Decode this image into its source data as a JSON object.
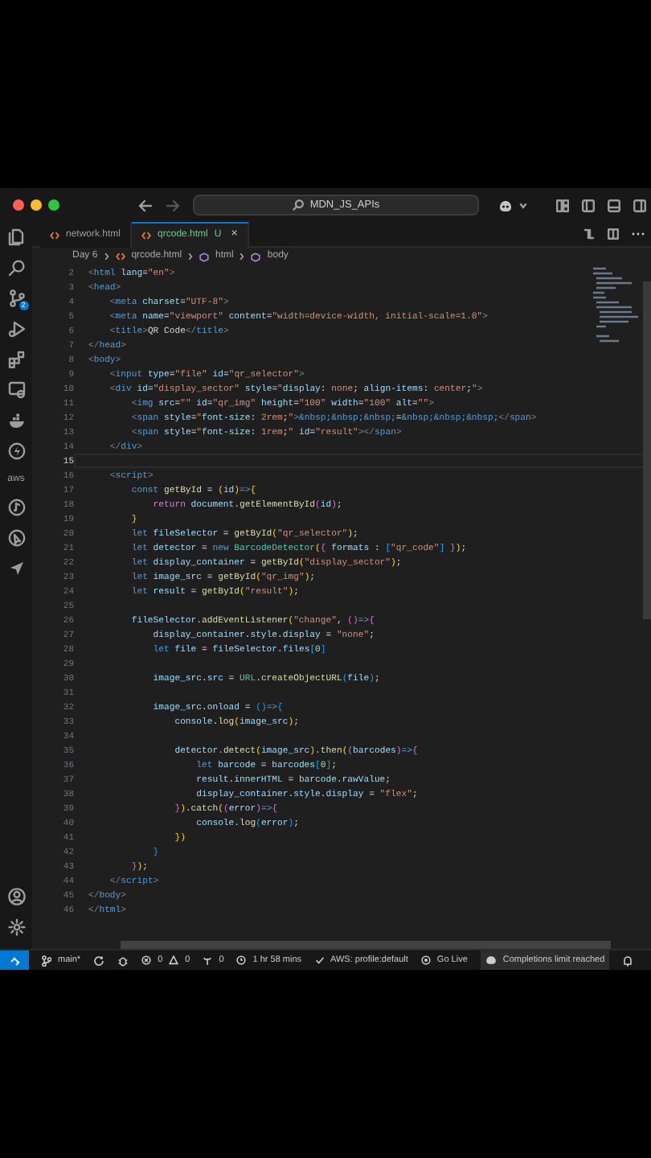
{
  "window": {
    "search": "MDN_JS_APIs"
  },
  "tabs": [
    {
      "label": "network.html",
      "selected": false
    },
    {
      "label": "qrcode.html",
      "selected": true,
      "badge": "U",
      "close": "×"
    }
  ],
  "breadcrumb": [
    {
      "label": "Day 6",
      "kind": "folder"
    },
    {
      "label": "qrcode.html",
      "kind": "file"
    },
    {
      "label": "html",
      "kind": "element"
    },
    {
      "label": "body",
      "kind": "element"
    }
  ],
  "activity_bar": {
    "scm_badge": "2",
    "aws_label": "aws"
  },
  "editor": {
    "lines": [
      {
        "number": "2",
        "current": false,
        "tokens": [
          {
            "kind": "delimiter",
            "text": "<"
          },
          {
            "kind": "tag",
            "text": "html"
          },
          {
            "kind": "attribute",
            "text": " lang"
          },
          {
            "kind": "plain",
            "text": "="
          },
          {
            "kind": "string",
            "text": "\"en\""
          },
          {
            "kind": "delimiter",
            "text": ">"
          }
        ]
      },
      {
        "number": "3",
        "current": false,
        "tokens": [
          {
            "kind": "delimiter",
            "text": "<"
          },
          {
            "kind": "tag",
            "text": "head"
          },
          {
            "kind": "delimiter",
            "text": ">"
          }
        ]
      },
      {
        "number": "4",
        "current": false,
        "tokens": [
          {
            "kind": "delimiter",
            "text": "    <"
          },
          {
            "kind": "tag",
            "text": "meta"
          },
          {
            "kind": "attribute",
            "text": " charset"
          },
          {
            "kind": "plain",
            "text": "="
          },
          {
            "kind": "string",
            "text": "\"UTF-8\""
          },
          {
            "kind": "delimiter",
            "text": ">"
          }
        ]
      },
      {
        "number": "5",
        "current": false,
        "tokens": [
          {
            "kind": "delimiter",
            "text": "    <"
          },
          {
            "kind": "tag",
            "text": "meta"
          },
          {
            "kind": "attribute",
            "text": " name"
          },
          {
            "kind": "plain",
            "text": "="
          },
          {
            "kind": "string",
            "text": "\"viewport\""
          },
          {
            "kind": "attribute",
            "text": " content"
          },
          {
            "kind": "plain",
            "text": "="
          },
          {
            "kind": "string",
            "text": "\"width=device-width, initial-scale=1.0\""
          },
          {
            "kind": "delimiter",
            "text": ">"
          }
        ]
      },
      {
        "number": "6",
        "current": false,
        "tokens": [
          {
            "kind": "delimiter",
            "text": "    <"
          },
          {
            "kind": "tag",
            "text": "title"
          },
          {
            "kind": "delimiter",
            "text": ">"
          },
          {
            "kind": "plain",
            "text": "QR Code"
          },
          {
            "kind": "delimiter",
            "text": "</"
          },
          {
            "kind": "tag",
            "text": "title"
          },
          {
            "kind": "delimiter",
            "text": ">"
          }
        ]
      },
      {
        "number": "7",
        "current": false,
        "tokens": [
          {
            "kind": "delimiter",
            "text": "</"
          },
          {
            "kind": "tag",
            "text": "head"
          },
          {
            "kind": "delimiter",
            "text": ">"
          }
        ]
      },
      {
        "number": "8",
        "current": false,
        "tokens": [
          {
            "kind": "delimiter",
            "text": "<"
          },
          {
            "kind": "tag",
            "text": "body"
          },
          {
            "kind": "delimiter",
            "text": ">"
          }
        ]
      },
      {
        "number": "9",
        "current": false,
        "tokens": [
          {
            "kind": "delimiter",
            "text": "    <"
          },
          {
            "kind": "tag",
            "text": "input"
          },
          {
            "kind": "attribute",
            "text": " type"
          },
          {
            "kind": "plain",
            "text": "="
          },
          {
            "kind": "string",
            "text": "\"file\""
          },
          {
            "kind": "attribute",
            "text": " id"
          },
          {
            "kind": "plain",
            "text": "="
          },
          {
            "kind": "string",
            "text": "\"qr_selector\""
          },
          {
            "kind": "delimiter",
            "text": ">"
          }
        ]
      },
      {
        "number": "10",
        "current": false,
        "tokens": [
          {
            "kind": "delimiter",
            "text": "    <"
          },
          {
            "kind": "tag",
            "text": "div"
          },
          {
            "kind": "attribute",
            "text": " id"
          },
          {
            "kind": "plain",
            "text": "="
          },
          {
            "kind": "string",
            "text": "\"display_sector\""
          },
          {
            "kind": "attribute",
            "text": " style"
          },
          {
            "kind": "plain",
            "text": "="
          },
          {
            "kind": "string",
            "text": "\""
          },
          {
            "kind": "attribute",
            "text": "display"
          },
          {
            "kind": "plain",
            "text": ": "
          },
          {
            "kind": "string",
            "text": "none"
          },
          {
            "kind": "plain",
            "text": "; "
          },
          {
            "kind": "attribute",
            "text": "align-items"
          },
          {
            "kind": "plain",
            "text": ": "
          },
          {
            "kind": "string",
            "text": "center"
          },
          {
            "kind": "plain",
            "text": ";"
          },
          {
            "kind": "string",
            "text": "\""
          },
          {
            "kind": "delimiter",
            "text": ">"
          }
        ]
      },
      {
        "number": "11",
        "current": false,
        "tokens": [
          {
            "kind": "delimiter",
            "text": "        <"
          },
          {
            "kind": "tag",
            "text": "img"
          },
          {
            "kind": "attribute",
            "text": " src"
          },
          {
            "kind": "plain",
            "text": "="
          },
          {
            "kind": "string",
            "text": "\"\""
          },
          {
            "kind": "attribute",
            "text": " id"
          },
          {
            "kind": "plain",
            "text": "="
          },
          {
            "kind": "string",
            "text": "\"qr_img\""
          },
          {
            "kind": "attribute",
            "text": " height"
          },
          {
            "kind": "plain",
            "text": "="
          },
          {
            "kind": "string",
            "text": "\"100\""
          },
          {
            "kind": "attribute",
            "text": " width"
          },
          {
            "kind": "plain",
            "text": "="
          },
          {
            "kind": "string",
            "text": "\"100\""
          },
          {
            "kind": "attribute",
            "text": " alt"
          },
          {
            "kind": "plain",
            "text": "="
          },
          {
            "kind": "string",
            "text": "\"\""
          },
          {
            "kind": "delimiter",
            "text": ">"
          }
        ]
      },
      {
        "number": "12",
        "current": false,
        "tokens": [
          {
            "kind": "delimiter",
            "text": "        <"
          },
          {
            "kind": "tag",
            "text": "span"
          },
          {
            "kind": "attribute",
            "text": " style"
          },
          {
            "kind": "plain",
            "text": "="
          },
          {
            "kind": "string",
            "text": "\""
          },
          {
            "kind": "attribute",
            "text": "font-size"
          },
          {
            "kind": "plain",
            "text": ": "
          },
          {
            "kind": "string",
            "text": "2rem"
          },
          {
            "kind": "plain",
            "text": ";"
          },
          {
            "kind": "string",
            "text": "\""
          },
          {
            "kind": "delimiter",
            "text": ">"
          },
          {
            "kind": "entity",
            "text": "&nbsp;&nbsp;&nbsp;"
          },
          {
            "kind": "plain",
            "text": "="
          },
          {
            "kind": "entity",
            "text": "&nbsp;&nbsp;&nbsp;"
          },
          {
            "kind": "delimiter",
            "text": "</"
          },
          {
            "kind": "tag",
            "text": "span"
          },
          {
            "kind": "delimiter",
            "text": ">"
          }
        ]
      },
      {
        "number": "13",
        "current": false,
        "tokens": [
          {
            "kind": "delimiter",
            "text": "        <"
          },
          {
            "kind": "tag",
            "text": "span"
          },
          {
            "kind": "attribute",
            "text": " style"
          },
          {
            "kind": "plain",
            "text": "="
          },
          {
            "kind": "string",
            "text": "\""
          },
          {
            "kind": "attribute",
            "text": "font-size"
          },
          {
            "kind": "plain",
            "text": ": "
          },
          {
            "kind": "string",
            "text": "1rem"
          },
          {
            "kind": "plain",
            "text": ";"
          },
          {
            "kind": "string",
            "text": "\""
          },
          {
            "kind": "attribute",
            "text": " id"
          },
          {
            "kind": "plain",
            "text": "="
          },
          {
            "kind": "string",
            "text": "\"result\""
          },
          {
            "kind": "delimiter",
            "text": "></"
          },
          {
            "kind": "tag",
            "text": "span"
          },
          {
            "kind": "delimiter",
            "text": ">"
          }
        ]
      },
      {
        "number": "14",
        "current": false,
        "tokens": [
          {
            "kind": "delimiter",
            "text": "    </"
          },
          {
            "kind": "tag",
            "text": "div"
          },
          {
            "kind": "delimiter",
            "text": ">"
          }
        ]
      },
      {
        "number": "15",
        "current": true
      },
      {
        "number": "16",
        "current": false,
        "tokens": [
          {
            "kind": "delimiter",
            "text": "    <"
          },
          {
            "kind": "tag",
            "text": "script"
          },
          {
            "kind": "delimiter",
            "text": ">"
          }
        ]
      },
      {
        "number": "17",
        "current": false,
        "tokens": [
          {
            "kind": "keyword",
            "text": "        const"
          },
          {
            "kind": "function",
            "text": " getById"
          },
          {
            "kind": "plain",
            "text": " = "
          },
          {
            "kind": "bracket_outer",
            "text": "("
          },
          {
            "kind": "variable",
            "text": "id"
          },
          {
            "kind": "bracket_outer",
            "text": ")"
          },
          {
            "kind": "keyword",
            "text": "=>"
          },
          {
            "kind": "bracket_outer",
            "text": "{"
          }
        ]
      },
      {
        "number": "18",
        "current": false,
        "tokens": [
          {
            "kind": "control",
            "text": "            return"
          },
          {
            "kind": "variable",
            "text": " document"
          },
          {
            "kind": "plain",
            "text": "."
          },
          {
            "kind": "function",
            "text": "getElementById"
          },
          {
            "kind": "bracket_mid",
            "text": "("
          },
          {
            "kind": "variable",
            "text": "id"
          },
          {
            "kind": "bracket_mid",
            "text": ")"
          },
          {
            "kind": "plain",
            "text": ";"
          }
        ]
      },
      {
        "number": "19",
        "current": false,
        "tokens": [
          {
            "kind": "bracket_outer",
            "text": "        }"
          }
        ]
      },
      {
        "number": "20",
        "current": false,
        "tokens": [
          {
            "kind": "keyword",
            "text": "        let"
          },
          {
            "kind": "variable",
            "text": " fileSelector"
          },
          {
            "kind": "plain",
            "text": " = "
          },
          {
            "kind": "function",
            "text": "getById"
          },
          {
            "kind": "bracket_outer",
            "text": "("
          },
          {
            "kind": "string",
            "text": "\"qr_selector\""
          },
          {
            "kind": "bracket_outer",
            "text": ")"
          },
          {
            "kind": "plain",
            "text": ";"
          }
        ]
      },
      {
        "number": "21",
        "current": false,
        "tokens": [
          {
            "kind": "keyword",
            "text": "        let"
          },
          {
            "kind": "variable",
            "text": " detector"
          },
          {
            "kind": "plain",
            "text": " = "
          },
          {
            "kind": "keyword",
            "text": "new"
          },
          {
            "kind": "type",
            "text": " BarcodeDetector"
          },
          {
            "kind": "bracket_outer",
            "text": "("
          },
          {
            "kind": "bracket_mid",
            "text": "{"
          },
          {
            "kind": "variable",
            "text": " formats"
          },
          {
            "kind": "plain",
            "text": " : "
          },
          {
            "kind": "bracket_inner",
            "text": "["
          },
          {
            "kind": "string",
            "text": "\"qr_code\""
          },
          {
            "kind": "bracket_inner",
            "text": "]"
          },
          {
            "kind": "bracket_mid",
            "text": " }"
          },
          {
            "kind": "bracket_outer",
            "text": ")"
          },
          {
            "kind": "plain",
            "text": ";"
          }
        ]
      },
      {
        "number": "22",
        "current": false,
        "tokens": [
          {
            "kind": "keyword",
            "text": "        let"
          },
          {
            "kind": "variable",
            "text": " display_container"
          },
          {
            "kind": "plain",
            "text": " = "
          },
          {
            "kind": "function",
            "text": "getById"
          },
          {
            "kind": "bracket_outer",
            "text": "("
          },
          {
            "kind": "string",
            "text": "\"display_sector\""
          },
          {
            "kind": "bracket_outer",
            "text": ")"
          },
          {
            "kind": "plain",
            "text": ";"
          }
        ]
      },
      {
        "number": "23",
        "current": false,
        "tokens": [
          {
            "kind": "keyword",
            "text": "        let"
          },
          {
            "kind": "variable",
            "text": " image_src"
          },
          {
            "kind": "plain",
            "text": " = "
          },
          {
            "kind": "function",
            "text": "getById"
          },
          {
            "kind": "bracket_outer",
            "text": "("
          },
          {
            "kind": "string",
            "text": "\"qr_img\""
          },
          {
            "kind": "bracket_outer",
            "text": ")"
          },
          {
            "kind": "plain",
            "text": ";"
          }
        ]
      },
      {
        "number": "24",
        "current": false,
        "tokens": [
          {
            "kind": "keyword",
            "text": "        let"
          },
          {
            "kind": "variable",
            "text": " result"
          },
          {
            "kind": "plain",
            "text": " = "
          },
          {
            "kind": "function",
            "text": "getById"
          },
          {
            "kind": "bracket_outer",
            "text": "("
          },
          {
            "kind": "string",
            "text": "\"result\""
          },
          {
            "kind": "bracket_outer",
            "text": ")"
          },
          {
            "kind": "plain",
            "text": ";"
          }
        ]
      },
      {
        "number": "25",
        "current": false
      },
      {
        "number": "26",
        "current": false,
        "tokens": [
          {
            "kind": "variable",
            "text": "        fileSelector"
          },
          {
            "kind": "plain",
            "text": "."
          },
          {
            "kind": "function",
            "text": "addEventListener"
          },
          {
            "kind": "bracket_outer",
            "text": "("
          },
          {
            "kind": "string",
            "text": "\"change\""
          },
          {
            "kind": "plain",
            "text": ", "
          },
          {
            "kind": "bracket_mid",
            "text": "()"
          },
          {
            "kind": "keyword",
            "text": "=>"
          },
          {
            "kind": "bracket_mid",
            "text": "{"
          }
        ]
      },
      {
        "number": "27",
        "current": false,
        "tokens": [
          {
            "kind": "variable",
            "text": "            display_container"
          },
          {
            "kind": "plain",
            "text": "."
          },
          {
            "kind": "variable",
            "text": "style"
          },
          {
            "kind": "plain",
            "text": "."
          },
          {
            "kind": "variable",
            "text": "display"
          },
          {
            "kind": "plain",
            "text": " = "
          },
          {
            "kind": "string",
            "text": "\"none\""
          },
          {
            "kind": "plain",
            "text": ";"
          }
        ]
      },
      {
        "number": "28",
        "current": false,
        "tokens": [
          {
            "kind": "keyword",
            "text": "            let"
          },
          {
            "kind": "variable",
            "text": " file"
          },
          {
            "kind": "plain",
            "text": " = "
          },
          {
            "kind": "variable",
            "text": "fileSelector"
          },
          {
            "kind": "plain",
            "text": "."
          },
          {
            "kind": "variable",
            "text": "files"
          },
          {
            "kind": "bracket_inner",
            "text": "["
          },
          {
            "kind": "number",
            "text": "0"
          },
          {
            "kind": "bracket_inner",
            "text": "]"
          }
        ]
      },
      {
        "number": "29",
        "current": false
      },
      {
        "number": "30",
        "current": false,
        "tokens": [
          {
            "kind": "variable",
            "text": "            image_src"
          },
          {
            "kind": "plain",
            "text": "."
          },
          {
            "kind": "variable",
            "text": "src"
          },
          {
            "kind": "plain",
            "text": " = "
          },
          {
            "kind": "type",
            "text": "URL"
          },
          {
            "kind": "plain",
            "text": "."
          },
          {
            "kind": "function",
            "text": "createObjectURL"
          },
          {
            "kind": "bracket_inner",
            "text": "("
          },
          {
            "kind": "variable",
            "text": "file"
          },
          {
            "kind": "bracket_inner",
            "text": ")"
          },
          {
            "kind": "plain",
            "text": ";"
          }
        ]
      },
      {
        "number": "31",
        "current": false
      },
      {
        "number": "32",
        "current": false,
        "tokens": [
          {
            "kind": "variable",
            "text": "            image_src"
          },
          {
            "kind": "plain",
            "text": "."
          },
          {
            "kind": "variable",
            "text": "onload"
          },
          {
            "kind": "plain",
            "text": " = "
          },
          {
            "kind": "bracket_inner",
            "text": "()"
          },
          {
            "kind": "keyword",
            "text": "=>"
          },
          {
            "kind": "bracket_inner",
            "text": "{"
          }
        ]
      },
      {
        "number": "33",
        "current": false,
        "tokens": [
          {
            "kind": "variable",
            "text": "                console"
          },
          {
            "kind": "plain",
            "text": "."
          },
          {
            "kind": "function",
            "text": "log"
          },
          {
            "kind": "bracket_outer",
            "text": "("
          },
          {
            "kind": "variable",
            "text": "image_src"
          },
          {
            "kind": "bracket_outer",
            "text": ")"
          },
          {
            "kind": "plain",
            "text": ";"
          }
        ]
      },
      {
        "number": "34",
        "current": false
      },
      {
        "number": "35",
        "current": false,
        "tokens": [
          {
            "kind": "variable",
            "text": "                detector"
          },
          {
            "kind": "plain",
            "text": "."
          },
          {
            "kind": "function",
            "text": "detect"
          },
          {
            "kind": "bracket_outer",
            "text": "("
          },
          {
            "kind": "variable",
            "text": "image_src"
          },
          {
            "kind": "bracket_outer",
            "text": ")"
          },
          {
            "kind": "plain",
            "text": "."
          },
          {
            "kind": "function",
            "text": "then"
          },
          {
            "kind": "bracket_outer",
            "text": "("
          },
          {
            "kind": "bracket_mid",
            "text": "("
          },
          {
            "kind": "variable",
            "text": "barcodes"
          },
          {
            "kind": "bracket_mid",
            "text": ")"
          },
          {
            "kind": "keyword",
            "text": "=>"
          },
          {
            "kind": "bracket_mid",
            "text": "{"
          }
        ]
      },
      {
        "number": "36",
        "current": false,
        "tokens": [
          {
            "kind": "keyword",
            "text": "                    let"
          },
          {
            "kind": "variable",
            "text": " barcode"
          },
          {
            "kind": "plain",
            "text": " = "
          },
          {
            "kind": "variable",
            "text": "barcodes"
          },
          {
            "kind": "bracket_inner",
            "text": "["
          },
          {
            "kind": "number",
            "text": "0"
          },
          {
            "kind": "bracket_inner",
            "text": "]"
          },
          {
            "kind": "plain",
            "text": ";"
          }
        ]
      },
      {
        "number": "37",
        "current": false,
        "tokens": [
          {
            "kind": "variable",
            "text": "                    result"
          },
          {
            "kind": "plain",
            "text": "."
          },
          {
            "kind": "variable",
            "text": "innerHTML"
          },
          {
            "kind": "plain",
            "text": " = "
          },
          {
            "kind": "variable",
            "text": "barcode"
          },
          {
            "kind": "plain",
            "text": "."
          },
          {
            "kind": "variable",
            "text": "rawValue"
          },
          {
            "kind": "plain",
            "text": ";"
          }
        ]
      },
      {
        "number": "38",
        "current": false,
        "tokens": [
          {
            "kind": "variable",
            "text": "                    display_container"
          },
          {
            "kind": "plain",
            "text": "."
          },
          {
            "kind": "variable",
            "text": "style"
          },
          {
            "kind": "plain",
            "text": "."
          },
          {
            "kind": "variable",
            "text": "display"
          },
          {
            "kind": "plain",
            "text": " = "
          },
          {
            "kind": "string",
            "text": "\"flex\""
          },
          {
            "kind": "plain",
            "text": ";"
          }
        ]
      },
      {
        "number": "39",
        "current": false,
        "tokens": [
          {
            "kind": "bracket_mid",
            "text": "                }"
          },
          {
            "kind": "bracket_outer",
            "text": ")"
          },
          {
            "kind": "plain",
            "text": "."
          },
          {
            "kind": "function",
            "text": "catch"
          },
          {
            "kind": "bracket_outer",
            "text": "("
          },
          {
            "kind": "bracket_mid",
            "text": "("
          },
          {
            "kind": "variable",
            "text": "error"
          },
          {
            "kind": "bracket_mid",
            "text": ")"
          },
          {
            "kind": "keyword",
            "text": "=>"
          },
          {
            "kind": "bracket_mid",
            "text": "{"
          }
        ]
      },
      {
        "number": "40",
        "current": false,
        "tokens": [
          {
            "kind": "variable",
            "text": "                    console"
          },
          {
            "kind": "plain",
            "text": "."
          },
          {
            "kind": "function",
            "text": "log"
          },
          {
            "kind": "bracket_inner",
            "text": "("
          },
          {
            "kind": "variable",
            "text": "error"
          },
          {
            "kind": "bracket_inner",
            "text": ")"
          },
          {
            "kind": "plain",
            "text": ";"
          }
        ]
      },
      {
        "number": "41",
        "current": false,
        "tokens": [
          {
            "kind": "bracket_outer",
            "text": "                })"
          }
        ]
      },
      {
        "number": "42",
        "current": false,
        "tokens": [
          {
            "kind": "bracket_inner",
            "text": "            }"
          }
        ]
      },
      {
        "number": "43",
        "current": false,
        "tokens": [
          {
            "kind": "bracket_mid",
            "text": "        }"
          },
          {
            "kind": "bracket_outer",
            "text": ")"
          },
          {
            "kind": "plain",
            "text": ";"
          }
        ]
      },
      {
        "number": "44",
        "current": false,
        "tokens": [
          {
            "kind": "delimiter",
            "text": "    </"
          },
          {
            "kind": "tag",
            "text": "script"
          },
          {
            "kind": "delimiter",
            "text": ">"
          }
        ]
      },
      {
        "number": "45",
        "current": false,
        "tokens": [
          {
            "kind": "delimiter",
            "text": "</"
          },
          {
            "kind": "tag",
            "text": "body"
          },
          {
            "kind": "delimiter",
            "text": ">"
          }
        ]
      },
      {
        "number": "46",
        "current": false,
        "tokens": [
          {
            "kind": "delimiter",
            "text": "</"
          },
          {
            "kind": "tag",
            "text": "html"
          },
          {
            "kind": "delimiter",
            "text": ">"
          }
        ]
      }
    ]
  },
  "status_bar": {
    "branch": "main*",
    "errors": "0",
    "warnings": "0",
    "ports": "0",
    "timer": "1 hr 58 mins",
    "aws": "AWS: profile:default",
    "go_live": "Go Live",
    "completions": "Completions limit reached"
  }
}
